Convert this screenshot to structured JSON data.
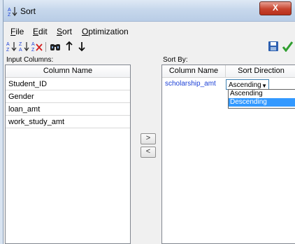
{
  "window": {
    "title": "Sort",
    "close_label": "X"
  },
  "menu": [
    "File",
    "Edit",
    "Sort",
    "Optimization"
  ],
  "menu_mnemonic": [
    "F",
    "E",
    "S",
    "O"
  ],
  "labels": {
    "input_columns": "Input Columns:",
    "sort_by": "Sort By:"
  },
  "input_columns": {
    "header": "Column Name",
    "rows": [
      "Student_ID",
      "Gender",
      "loan_amt",
      "work_study_amt"
    ]
  },
  "sort_by": {
    "headers": [
      "Column Name",
      "Sort Direction"
    ],
    "rows": [
      {
        "column": "scholarship_amt",
        "direction": "Ascending"
      }
    ]
  },
  "dropdown_options": [
    "Ascending",
    "Descending"
  ],
  "selected_option": "Descending",
  "buttons": {
    "move_right": ">",
    "move_left": "<"
  },
  "colors": {
    "link": "#1a3fd6",
    "selection": "#3399ff",
    "titlebar": "#c7d8ec"
  }
}
